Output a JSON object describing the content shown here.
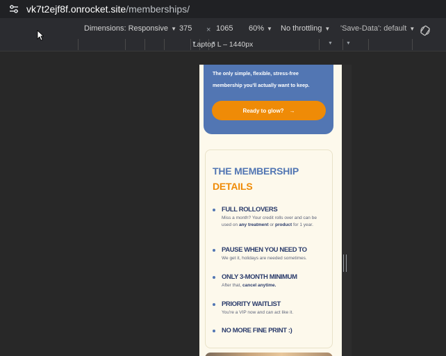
{
  "browser": {
    "url_host": "vk7t2ejf8f.onrocket.site",
    "url_path": "/memberships/"
  },
  "devtools": {
    "dimensions_label": "Dimensions: Responsive",
    "width": "375",
    "times": "×",
    "height": "1065",
    "zoom": "60%",
    "throttling": "No throttling",
    "save_data": "'Save-Data': default",
    "media_query_label": "Laptop L – 1440px"
  },
  "page": {
    "hero_tagline": "The only simple, flexible, stress-free membership you'll actually want to keep.",
    "cta_label": "Ready to glow?",
    "cta_arrow": "→",
    "title_line1": "THE MEMBERSHIP",
    "title_line2": "DETAILS",
    "items": [
      {
        "heading": "FULL ROLLOVERS",
        "pre": "Miss a month? Your credit rolls over and can be used on ",
        "b1": "any treatment",
        "mid": " or ",
        "b2": "product",
        "post": " for 1 year."
      },
      {
        "heading": "PAUSE WHEN YOU NEED TO",
        "body": "We get it, holidays are needed sometimes."
      },
      {
        "heading": "ONLY 3-MONTH MINIMUM",
        "pre": "After that, ",
        "b1": "cancel anytime."
      },
      {
        "heading": "PRIORITY WAITLIST",
        "body": "You're a VIP now and can act like it."
      },
      {
        "heading": "NO MORE FINE PRINT :)"
      }
    ]
  },
  "colors": {
    "brand_blue": "#5276b3",
    "brand_orange": "#ef8b07",
    "page_bg": "#fdf9ec"
  }
}
